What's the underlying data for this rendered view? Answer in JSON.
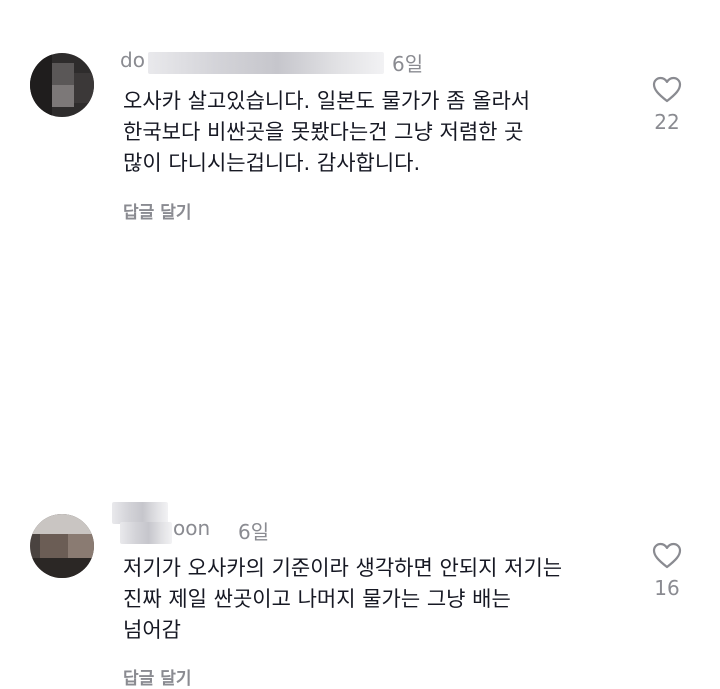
{
  "comments": [
    {
      "username_visible": "do",
      "time": "6일",
      "lines": [
        "오사카 살고있습니다. 일본도 물가가 좀 올라서",
        "한국보다 비싼곳을 못봤다는건 그냥 저렴한 곳",
        "많이 다니시는겁니다. 감사합니다."
      ],
      "reply_label": "답글 달기",
      "like_count": "22",
      "like_icon": "heart-outline-icon"
    },
    {
      "username_visible": "oon",
      "time": "6일",
      "lines": [
        "저기가 오사카의 기준이라 생각하면 안되지 저기는",
        "진짜 제일 싼곳이고 나머지 물가는 그냥 배는",
        "넘어감"
      ],
      "reply_label": "답글 달기",
      "like_count": "16",
      "like_icon": "heart-outline-icon"
    }
  ]
}
